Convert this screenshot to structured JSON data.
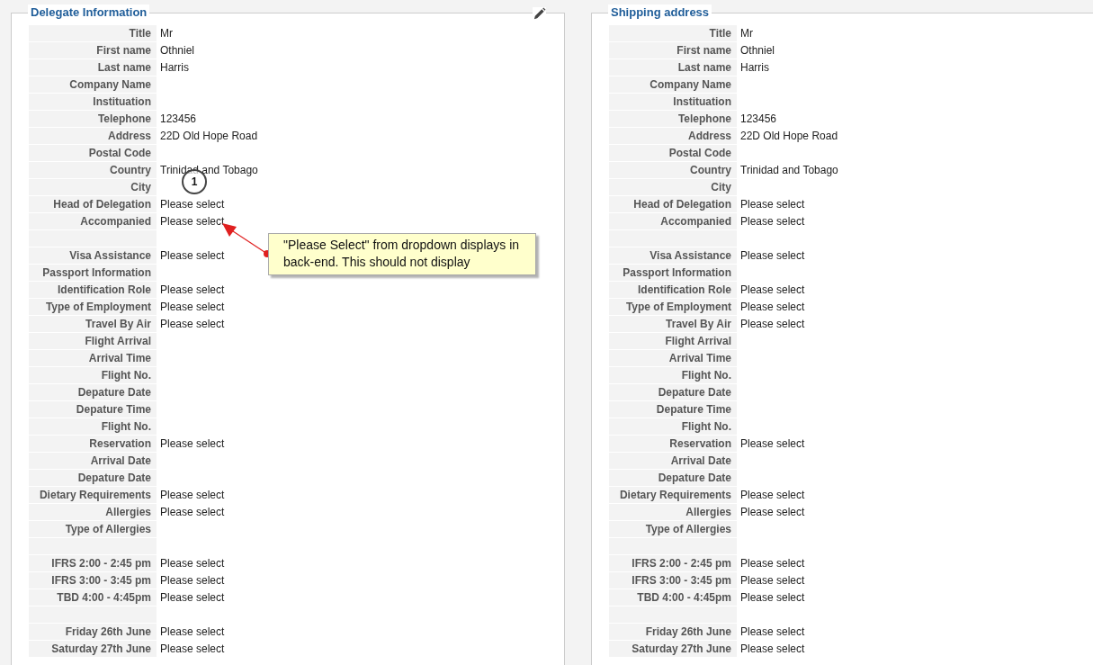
{
  "panels": [
    {
      "title": "Delegate Information",
      "editable": true,
      "sections": [
        {
          "fields": [
            {
              "label": "Title",
              "value": "Mr"
            },
            {
              "label": "First name",
              "value": "Othniel"
            },
            {
              "label": "Last name",
              "value": "Harris"
            },
            {
              "label": "Company Name"
            },
            {
              "label": "Instituation"
            },
            {
              "label": "Telephone",
              "value": "123456"
            },
            {
              "label": "Address",
              "value": "22D Old Hope Road"
            },
            {
              "label": "Postal Code"
            },
            {
              "label": "Country",
              "value": "Trinidad and Tobago"
            },
            {
              "label": "City"
            },
            {
              "label": "Head of Delegation",
              "value": "Please select"
            },
            {
              "label": "Accompanied",
              "value": "Please select"
            }
          ]
        },
        {
          "fields": [
            {
              "label": "Visa Assistance",
              "value": "Please select"
            },
            {
              "label": "Passport Information"
            },
            {
              "label": "Identification Role",
              "value": "Please select"
            },
            {
              "label": "Type of Employment",
              "value": "Please select"
            },
            {
              "label": "Travel By Air",
              "value": "Please select"
            },
            {
              "label": "Flight Arrival"
            },
            {
              "label": "Arrival Time"
            },
            {
              "label": "Flight No."
            },
            {
              "label": "Depature Date"
            },
            {
              "label": "Depature Time"
            },
            {
              "label": "Flight No."
            },
            {
              "label": "Reservation",
              "value": "Please select"
            },
            {
              "label": "Arrival Date"
            },
            {
              "label": "Depature Date"
            },
            {
              "label": "Dietary Requirements",
              "value": "Please select"
            },
            {
              "label": "Allergies",
              "value": "Please select"
            },
            {
              "label": "Type of Allergies"
            }
          ]
        },
        {
          "fields": [
            {
              "label": "IFRS 2:00 - 2:45 pm",
              "value": "Please select"
            },
            {
              "label": "IFRS 3:00 - 3:45 pm",
              "value": "Please select"
            },
            {
              "label": "TBD 4:00 - 4:45pm",
              "value": "Please select"
            }
          ]
        },
        {
          "fields": [
            {
              "label": "Friday 26th June",
              "value": "Please select"
            },
            {
              "label": "Saturday 27th June",
              "value": "Please select"
            }
          ]
        }
      ]
    },
    {
      "title": "Shipping address",
      "editable": false,
      "sections": [
        {
          "fields": [
            {
              "label": "Title",
              "value": "Mr"
            },
            {
              "label": "First name",
              "value": "Othniel"
            },
            {
              "label": "Last name",
              "value": "Harris"
            },
            {
              "label": "Company Name"
            },
            {
              "label": "Instituation"
            },
            {
              "label": "Telephone",
              "value": "123456"
            },
            {
              "label": "Address",
              "value": "22D Old Hope Road"
            },
            {
              "label": "Postal Code"
            },
            {
              "label": "Country",
              "value": "Trinidad and Tobago"
            },
            {
              "label": "City"
            },
            {
              "label": "Head of Delegation",
              "value": "Please select"
            },
            {
              "label": "Accompanied",
              "value": "Please select"
            }
          ]
        },
        {
          "fields": [
            {
              "label": "Visa Assistance",
              "value": "Please select"
            },
            {
              "label": "Passport Information"
            },
            {
              "label": "Identification Role",
              "value": "Please select"
            },
            {
              "label": "Type of Employment",
              "value": "Please select"
            },
            {
              "label": "Travel By Air",
              "value": "Please select"
            },
            {
              "label": "Flight Arrival"
            },
            {
              "label": "Arrival Time"
            },
            {
              "label": "Flight No."
            },
            {
              "label": "Depature Date"
            },
            {
              "label": "Depature Time"
            },
            {
              "label": "Flight No."
            },
            {
              "label": "Reservation",
              "value": "Please select"
            },
            {
              "label": "Arrival Date"
            },
            {
              "label": "Depature Date"
            },
            {
              "label": "Dietary Requirements",
              "value": "Please select"
            },
            {
              "label": "Allergies",
              "value": "Please select"
            },
            {
              "label": "Type of Allergies"
            }
          ]
        },
        {
          "fields": [
            {
              "label": "IFRS 2:00 - 2:45 pm",
              "value": "Please select"
            },
            {
              "label": "IFRS 3:00 - 3:45 pm",
              "value": "Please select"
            },
            {
              "label": "TBD 4:00 - 4:45pm",
              "value": "Please select"
            }
          ]
        },
        {
          "fields": [
            {
              "label": "Friday 26th June",
              "value": "Please select"
            },
            {
              "label": "Saturday 27th June",
              "value": "Please select"
            }
          ]
        }
      ]
    }
  ],
  "annotation": {
    "number": "1",
    "note": "\"Please Select\" from dropdown displays in back-end. This should not display"
  }
}
